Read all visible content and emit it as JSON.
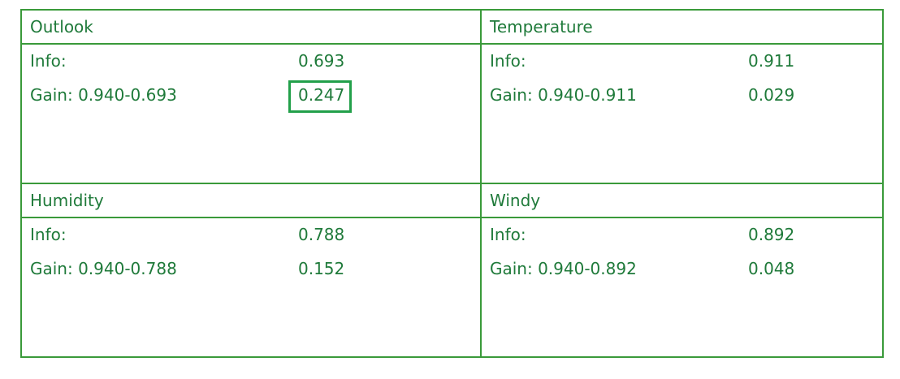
{
  "colors": {
    "border": "#3a9a3a",
    "text": "#1f7a3a",
    "highlight": "#22a04a"
  },
  "panels": [
    {
      "title": "Outlook",
      "info_label": "Info:",
      "info_value": "0.693",
      "gain_label": "Gain: 0.940-0.693",
      "gain_value": "0.247",
      "gain_highlighted": true
    },
    {
      "title": "Temperature",
      "info_label": "Info:",
      "info_value": "0.911",
      "gain_label": "Gain: 0.940-0.911",
      "gain_value": "0.029",
      "gain_highlighted": false
    },
    {
      "title": "Humidity",
      "info_label": "Info:",
      "info_value": "0.788",
      "gain_label": "Gain: 0.940-0.788",
      "gain_value": "0.152",
      "gain_highlighted": false
    },
    {
      "title": "Windy",
      "info_label": "Info:",
      "info_value": "0.892",
      "gain_label": "Gain: 0.940-0.892",
      "gain_value": "0.048",
      "gain_highlighted": false
    }
  ]
}
